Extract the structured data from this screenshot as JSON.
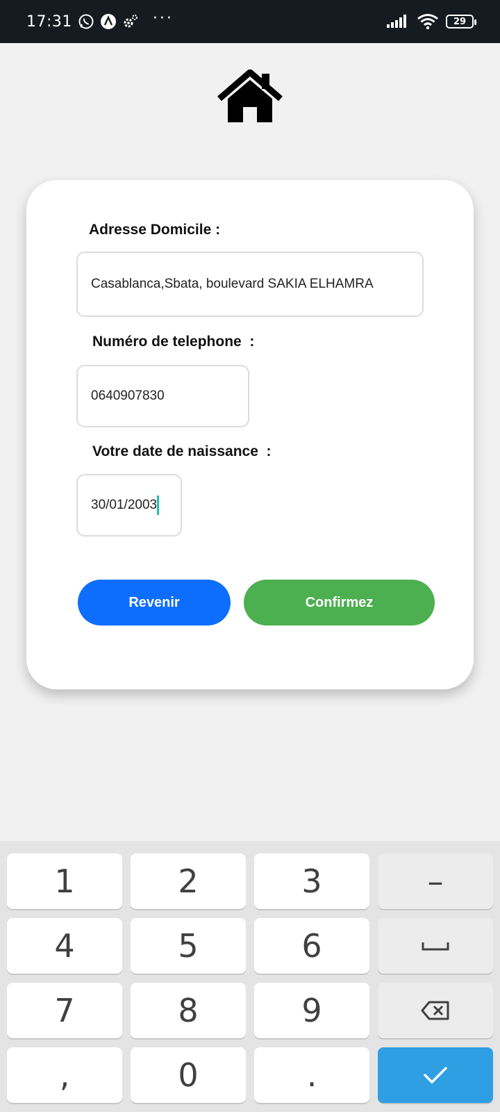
{
  "status_bar": {
    "time": "17:31",
    "icons": [
      "whatsapp-icon",
      "app-a-icon",
      "settings-gear-icon",
      "more-dots-icon"
    ],
    "more": "···",
    "battery": "29",
    "right_icons": [
      "signal-icon",
      "wifi-icon",
      "battery-icon"
    ]
  },
  "header": {
    "icon": "home-icon"
  },
  "form": {
    "address_label": "Adresse Domicile :",
    "address_value": "Casablanca,Sbata, boulevard SAKIA ELHAMRA",
    "phone_label": "Numéro de telephone  :",
    "phone_value": "0640907830",
    "birthdate_label": "Votre date de naissance  :",
    "birthdate_value": "30/01/2003",
    "back_button": "Revenir",
    "confirm_button": "Confirmez"
  },
  "keyboard": {
    "keys": [
      "1",
      "2",
      "3",
      "4",
      "5",
      "6",
      "7",
      "8",
      "9",
      ",",
      "0",
      "."
    ],
    "fn_keys": [
      "minus-key",
      "space-key",
      "backspace-key",
      "enter-check-key"
    ],
    "minus": "–",
    "accent_color": "#2f9fe3"
  },
  "colors": {
    "back_button": "#0d6efd",
    "confirm_button": "#4caf50",
    "status_bar": "#161b22"
  }
}
